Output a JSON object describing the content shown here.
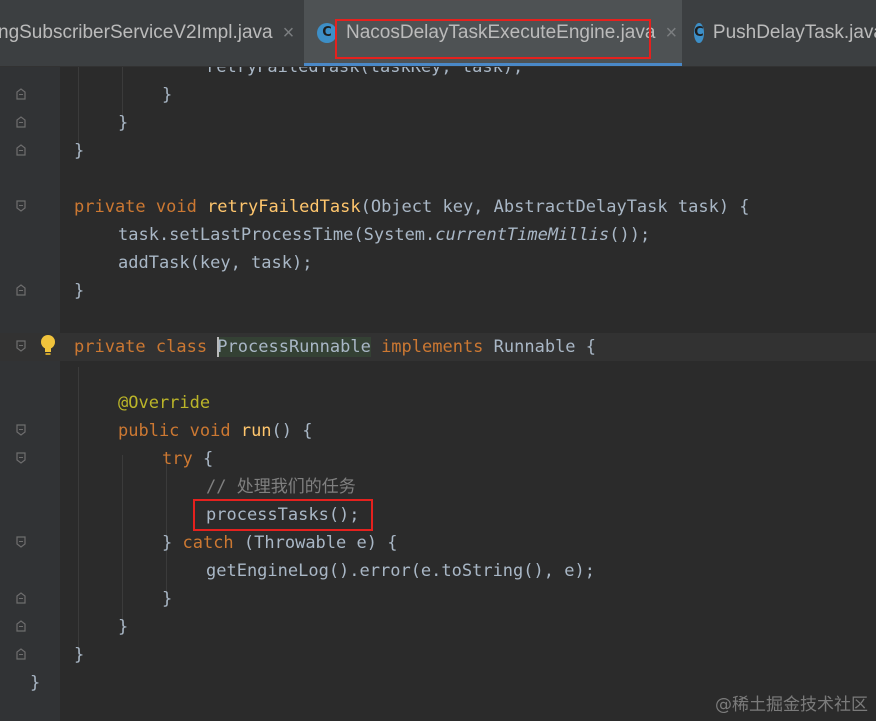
{
  "tabs": [
    {
      "label": "ngSubscriberServiceV2Impl.java",
      "close": "×",
      "has_icon": false,
      "active": false
    },
    {
      "label": "NacosDelayTaskExecuteEngine.java",
      "close": "×",
      "icon": "C",
      "has_icon": true,
      "active": true
    },
    {
      "label": "PushDelayTask.java",
      "icon": "C",
      "has_icon": true,
      "active": false
    }
  ],
  "code": {
    "l0": {
      "a": "retryFailedTask(taskKey, task);"
    },
    "l1": {
      "a": "}"
    },
    "l2": {
      "a": "}"
    },
    "l3": {
      "a": "}"
    },
    "l5": {
      "k1": "private void ",
      "f": "retryFailedTask",
      "p": "(Object key, AbstractDelayTask task) {"
    },
    "l6": {
      "a": "task.setLastProcessTime(System.",
      "i": "currentTimeMillis",
      "b": "());"
    },
    "l7": {
      "a": "addTask(key, task);"
    },
    "l8": {
      "a": "}"
    },
    "l10": {
      "k1": "private class ",
      "c": "ProcessRunnable",
      "k2": " implements ",
      "p": "Runnable {"
    },
    "l12": {
      "ann": "@Override"
    },
    "l13": {
      "k1": "public void ",
      "f": "run",
      "p": "() {"
    },
    "l14": {
      "k1": "try ",
      "p": "{"
    },
    "l15": {
      "cmt": "// 处理我们的任务"
    },
    "l16": {
      "a": "processTasks();"
    },
    "l17": {
      "p1": "} ",
      "k1": "catch ",
      "p": "(Throwable e) {"
    },
    "l18": {
      "a": "getEngineLog().error(e.toString(), e);"
    },
    "l19": {
      "a": "}"
    },
    "l20": {
      "a": "}"
    },
    "l21": {
      "a": "}"
    },
    "l22": {
      "a": "}"
    }
  },
  "watermark": "@稀土掘金技术社区",
  "colors": {
    "keyword": "#cc7832",
    "function": "#ffc66d",
    "annotation": "#bbb529",
    "comment": "#808080",
    "text": "#a9b7c6",
    "highlight_box": "#e5211e"
  }
}
